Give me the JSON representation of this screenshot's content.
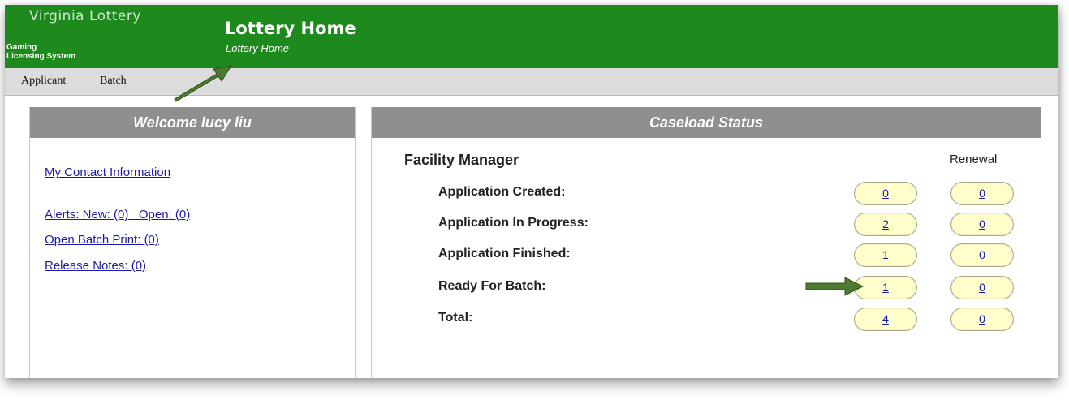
{
  "header": {
    "brand": "Virginia Lottery",
    "system_line1": "Gaming",
    "system_line2": "Licensing System",
    "title": "Lottery Home",
    "subtitle": "Lottery Home"
  },
  "menu": {
    "items": [
      {
        "label": "Applicant"
      },
      {
        "label": "Batch"
      }
    ]
  },
  "welcome_panel": {
    "title": "Welcome lucy liu",
    "links": [
      {
        "label": "My Contact Information"
      },
      {
        "label": "Alerts: New: (0)   Open: (0)"
      },
      {
        "label": "Open Batch Print: (0)"
      },
      {
        "label": "Release Notes: (0)"
      }
    ]
  },
  "caseload_panel": {
    "title": "Caseload Status",
    "section_title": "Facility Manager",
    "renewal_label": "Renewal",
    "rows": [
      {
        "label": "Application Created:",
        "value": "0",
        "renewal": "0"
      },
      {
        "label": "Application In Progress:",
        "value": "2",
        "renewal": "0"
      },
      {
        "label": "Application Finished:",
        "value": "1",
        "renewal": "0"
      },
      {
        "label": "Ready For Batch:",
        "value": "1",
        "renewal": "0"
      },
      {
        "label": "Total:",
        "value": "4",
        "renewal": "0"
      }
    ]
  },
  "colors": {
    "header_green": "#1e8a1e",
    "panel_header_gray": "#8f8f8f",
    "pill_fill": "#ffffcc",
    "link_blue": "#1a1aa6",
    "annotation_arrow": "#4e7a30"
  },
  "annotations": [
    {
      "icon": "arrow-icon",
      "points_to": "page-subtitle"
    },
    {
      "icon": "arrow-icon",
      "points_to": "ready-for-batch-count"
    }
  ]
}
